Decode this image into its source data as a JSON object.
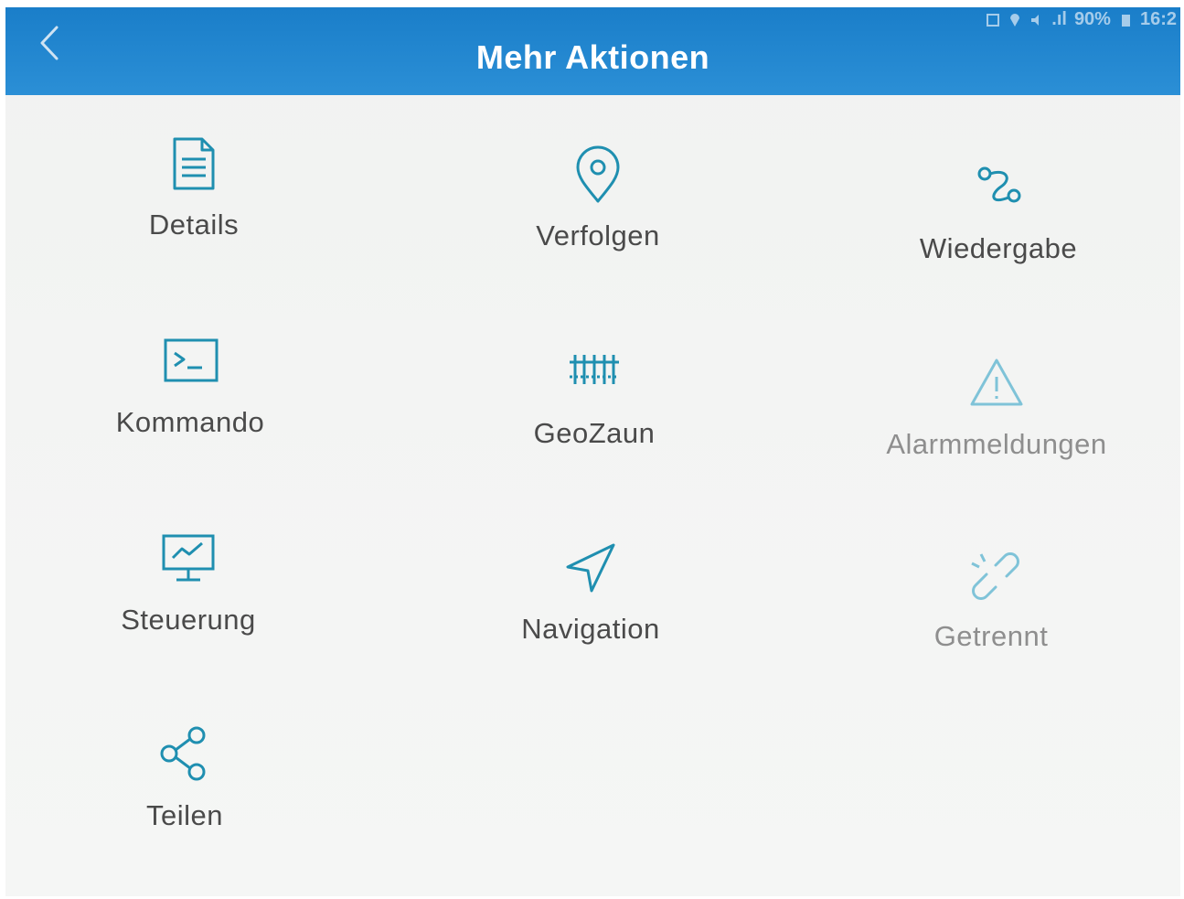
{
  "app_bar": {
    "title": "Mehr Aktionen",
    "back_icon": "chevron-left-icon",
    "background": "#1a7ec9"
  },
  "status_bar": {
    "signal": ".ıl",
    "battery": "90%",
    "time": "16:2"
  },
  "accent_color": "#1f8fb0",
  "actions": [
    {
      "id": "details",
      "label": "Details",
      "icon": "document-icon",
      "enabled": true
    },
    {
      "id": "verfolgen",
      "label": "Verfolgen",
      "icon": "location-pin-icon",
      "enabled": true
    },
    {
      "id": "wiedergabe",
      "label": "Wiedergabe",
      "icon": "route-icon",
      "enabled": true
    },
    {
      "id": "kommando",
      "label": "Kommando",
      "icon": "terminal-icon",
      "enabled": true
    },
    {
      "id": "geozaun",
      "label": "GeoZaun",
      "icon": "fence-icon",
      "enabled": true
    },
    {
      "id": "alarmmeldungen",
      "label": "Alarmmeldungen",
      "icon": "warning-icon",
      "enabled": false
    },
    {
      "id": "steuerung",
      "label": "Steuerung",
      "icon": "monitor-icon",
      "enabled": true
    },
    {
      "id": "navigation",
      "label": "Navigation",
      "icon": "navigation-arrow-icon",
      "enabled": true
    },
    {
      "id": "getrennt",
      "label": "Getrennt",
      "icon": "broken-link-icon",
      "enabled": false
    },
    {
      "id": "teilen",
      "label": "Teilen",
      "icon": "share-icon",
      "enabled": true
    }
  ]
}
